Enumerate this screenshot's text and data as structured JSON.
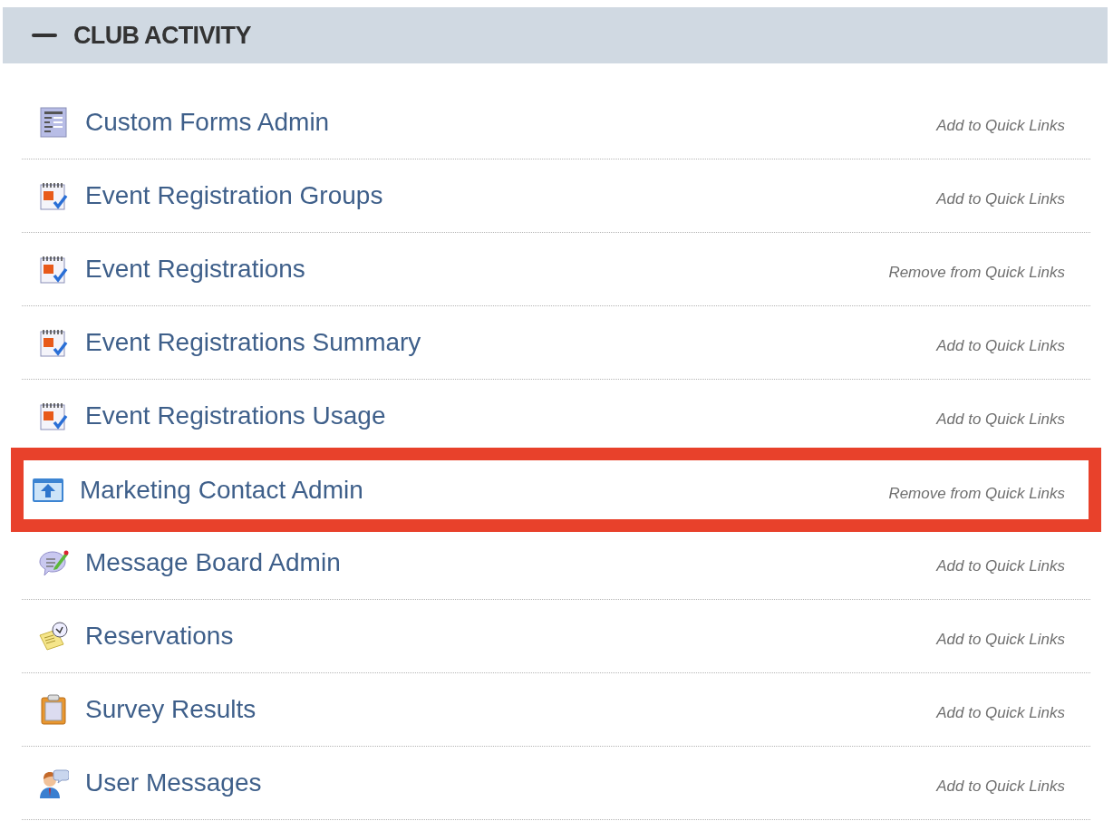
{
  "section": {
    "title": "CLUB ACTIVITY",
    "expanded": true
  },
  "items": [
    {
      "kind": "form",
      "label": "Custom Forms Admin",
      "quick_link": "Add to Quick Links",
      "highlighted": false
    },
    {
      "kind": "calendar",
      "label": "Event Registration Groups",
      "quick_link": "Add to Quick Links",
      "highlighted": false
    },
    {
      "kind": "calendar",
      "label": "Event Registrations",
      "quick_link": "Remove from Quick Links",
      "highlighted": false
    },
    {
      "kind": "calendar",
      "label": "Event Registrations Summary",
      "quick_link": "Add to Quick Links",
      "highlighted": false
    },
    {
      "kind": "calendar",
      "label": "Event Registrations Usage",
      "quick_link": "Add to Quick Links",
      "highlighted": false
    },
    {
      "kind": "window",
      "label": "Marketing Contact Admin",
      "quick_link": "Remove from Quick Links",
      "highlighted": true
    },
    {
      "kind": "message",
      "label": "Message Board Admin",
      "quick_link": "Add to Quick Links",
      "highlighted": false
    },
    {
      "kind": "reservation",
      "label": "Reservations",
      "quick_link": "Add to Quick Links",
      "highlighted": false
    },
    {
      "kind": "clipboard",
      "label": "Survey Results",
      "quick_link": "Add to Quick Links",
      "highlighted": false
    },
    {
      "kind": "user",
      "label": "User Messages",
      "quick_link": "Add to Quick Links",
      "highlighted": false
    }
  ]
}
